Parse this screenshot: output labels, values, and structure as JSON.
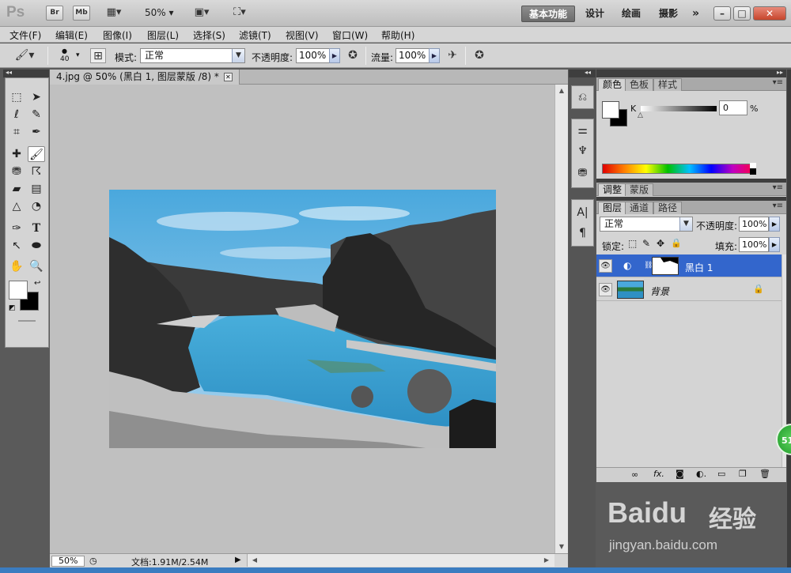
{
  "app": {
    "logo": "Ps",
    "bridge": "Br",
    "minibridge": "Mb",
    "zoom": "50%",
    "workspaces": [
      "基本功能",
      "设计",
      "绘画",
      "摄影"
    ],
    "more": "»",
    "win_min": "–",
    "win_max": "□",
    "win_close": "✕"
  },
  "menu": [
    "文件(F)",
    "编辑(E)",
    "图像(I)",
    "图层(L)",
    "选择(S)",
    "滤镜(T)",
    "视图(V)",
    "窗口(W)",
    "帮助(H)"
  ],
  "options": {
    "brush_size": "40",
    "mode_label": "模式:",
    "mode_value": "正常",
    "opacity_label": "不透明度:",
    "opacity_value": "100%",
    "flow_label": "流量:",
    "flow_value": "100%"
  },
  "document": {
    "tab_title": "4.jpg @ 50% (黑白 1, 图层蒙版 /8) *",
    "zoom": "50%",
    "doc_info": "文档:1.91M/2.54M"
  },
  "color_panel": {
    "tabs": [
      "颜色",
      "色板",
      "样式"
    ],
    "channel": "K",
    "value": "0",
    "unit": "%"
  },
  "adjust_panel": {
    "tabs": [
      "调整",
      "蒙版"
    ]
  },
  "layers_panel": {
    "tabs": [
      "图层",
      "通道",
      "路径"
    ],
    "blend_mode": "正常",
    "opacity_label": "不透明度:",
    "opacity_value": "100%",
    "lock_label": "锁定:",
    "fill_label": "填充:",
    "fill_value": "100%",
    "layers": [
      {
        "name": "黑白 1",
        "selected": true
      },
      {
        "name": "背景",
        "selected": false,
        "locked": true
      }
    ],
    "footer_icons": [
      "link-icon",
      "fx-icon",
      "mask-icon",
      "adjustment-icon",
      "group-icon",
      "new-layer-icon",
      "trash-icon"
    ]
  },
  "watermark": {
    "brand": "Baidu",
    "brand_cn": "经验",
    "url": "jingyan.baidu.com"
  },
  "badge": "51"
}
